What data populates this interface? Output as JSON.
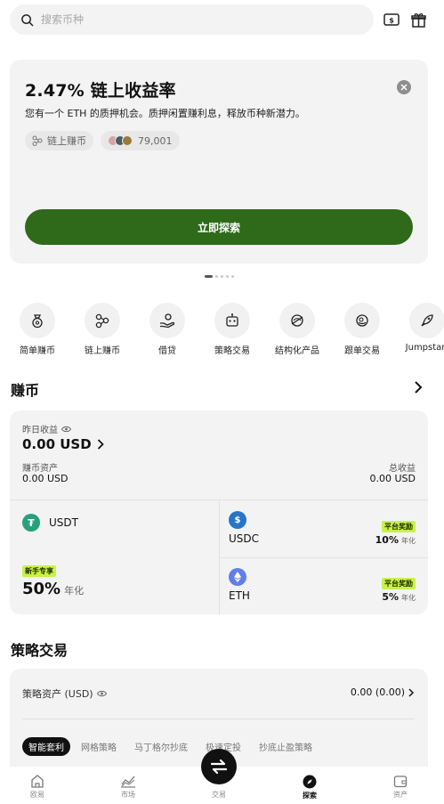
{
  "search": {
    "placeholder": "搜索币种"
  },
  "promo": {
    "title": "2.47% 链上收益率",
    "description": "您有一个 ETH 的质押机会。质押闲置赚利息，释放币种新潜力。",
    "tag": "链上赚币",
    "participants": "79,001",
    "button": "立即探索",
    "button_color": "#2f6a1a"
  },
  "quick_actions": [
    {
      "label": "简单赚币",
      "icon": "money-bag-icon"
    },
    {
      "label": "链上赚币",
      "icon": "nodes-icon"
    },
    {
      "label": "借贷",
      "icon": "hand-coin-icon"
    },
    {
      "label": "策略交易",
      "icon": "robot-icon"
    },
    {
      "label": "结构化产品",
      "icon": "structure-icon"
    },
    {
      "label": "跟单交易",
      "icon": "copy-trade-icon"
    },
    {
      "label": "Jumpstart",
      "icon": "rocket-icon"
    }
  ],
  "earn": {
    "section_title": "赚币",
    "yesterday_label": "昨日收益",
    "yesterday_value": "0.00 USD",
    "asset_label": "赚币资产",
    "asset_value": "0.00 USD",
    "total_label": "总收益",
    "total_value": "0.00 USD",
    "products": [
      {
        "coin": "USDT",
        "badge": "新手专享",
        "apy": "50%",
        "unit": "年化",
        "color": "#26a17b"
      },
      {
        "coin": "USDC",
        "badge": "平台奖励",
        "apy": "10%",
        "unit": "年化",
        "color": "#2775ca"
      },
      {
        "coin": "ETH",
        "badge": "平台奖励",
        "apy": "5%",
        "unit": "年化",
        "color": "#627eea"
      }
    ]
  },
  "strategy": {
    "section_title": "策略交易",
    "asset_label": "策略资产 (USD)",
    "asset_value": "0.00 (0.00)",
    "tabs": [
      "智能套利",
      "网格策略",
      "马丁格尔抄底",
      "极速定投",
      "抄底止盈策略"
    ]
  },
  "bottom_nav": {
    "items": [
      "欧易",
      "市场",
      "交易",
      "探索",
      "资产"
    ],
    "active": "探索"
  }
}
